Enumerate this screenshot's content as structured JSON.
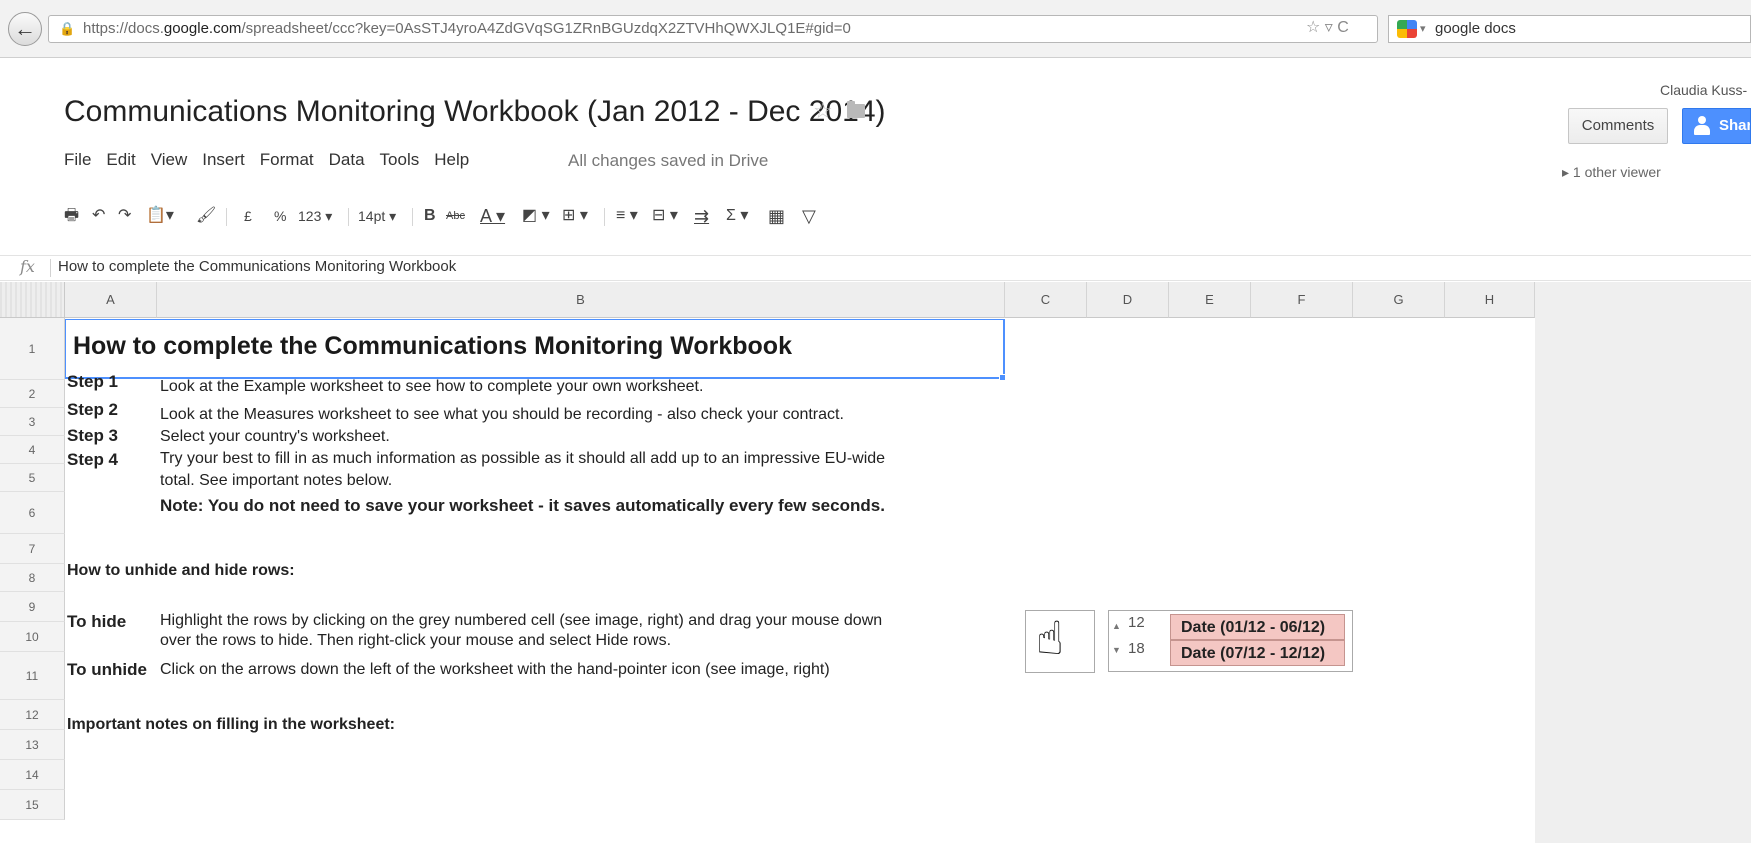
{
  "browser": {
    "back_icon": "←",
    "url_prefix": "https://docs.",
    "url_host": "google.com",
    "url_rest": "/spreadsheet/ccc?key=0AsSTJ4yroA4ZdGVqSG1ZRnBGUzdqX2ZTVHhQWXJLQ1E#gid=0",
    "url_actions": "☆ ▿ C",
    "search_text": "google docs"
  },
  "doc": {
    "title": "Communications Monitoring Workbook (Jan 2012 - Dec 2014)",
    "star_icon": "☆",
    "user_name": "Claudia Kuss-",
    "comments_label": "Comments",
    "share_label": "Share",
    "viewers": "▸ 1 other viewer",
    "saved_status": "All changes saved in Drive"
  },
  "menu": [
    "File",
    "Edit",
    "View",
    "Insert",
    "Format",
    "Data",
    "Tools",
    "Help"
  ],
  "toolbar": {
    "print": "🖶",
    "undo": "↶",
    "redo": "↷",
    "paste": "📋▾",
    "paint": "🖌",
    "currency": "£",
    "percent": "%",
    "number_format": "123 ▾",
    "font_size": "14pt ▾",
    "bold": "B",
    "strike": "Abc",
    "text_color": "A ▾",
    "fill_color": "◩ ▾",
    "borders": "⊞ ▾",
    "align": "≡ ▾",
    "merge": "⊟ ▾",
    "wrap": "⇉",
    "functions": "Σ ▾",
    "chart": "▦",
    "filter": "▽"
  },
  "formula": {
    "fx_label": "fx",
    "content": "How to complete the Communications Monitoring Workbook"
  },
  "columns": [
    "A",
    "B",
    "C",
    "D",
    "E",
    "F",
    "G",
    "H"
  ],
  "rows": [
    "1",
    "2",
    "3",
    "4",
    "5",
    "6",
    "7",
    "8",
    "9",
    "10",
    "11",
    "12",
    "13",
    "14",
    "15"
  ],
  "sheet": {
    "a1": "How to complete the Communications Monitoring Workbook",
    "step1_label": "Step 1",
    "step1_text": "Look at the Example worksheet to see how to complete your own worksheet.",
    "step2_label": "Step 2",
    "step2_text": "Look at the Measures worksheet to see what you should be recording - also check your contract.",
    "step3_label": "Step 3",
    "step3_text": "Select your country's worksheet.",
    "step4_label": "Step 4",
    "step4_text_1": "Try your best to fill in as much information as possible as it should all add up to an impressive EU-wide",
    "step4_text_2": "total. See important notes below.",
    "note": "Note: You do not need to save your worksheet - it saves automatically every few seconds.",
    "hide_heading": "How to unhide and hide rows:",
    "hide_label": "To hide",
    "hide_text_1": "Highlight the rows by clicking on the grey numbered cell (see image, right) and drag your mouse down",
    "hide_text_2": "over the rows to hide. Then right-click your mouse and select Hide rows.",
    "unhide_label": "To unhide",
    "unhide_text": "Click on the arrows down the left of the worksheet with the hand-pointer icon (see image, right)",
    "notes_heading": "Important notes on filling in the worksheet:"
  },
  "illustration": {
    "hand_icon": "☝",
    "row_a_num": "12",
    "row_a_date": "Date (01/12 - 06/12)",
    "row_b_num": "18",
    "row_b_date": "Date (07/12 - 12/12)",
    "arrow_up": "▲",
    "arrow_down": "▼"
  }
}
